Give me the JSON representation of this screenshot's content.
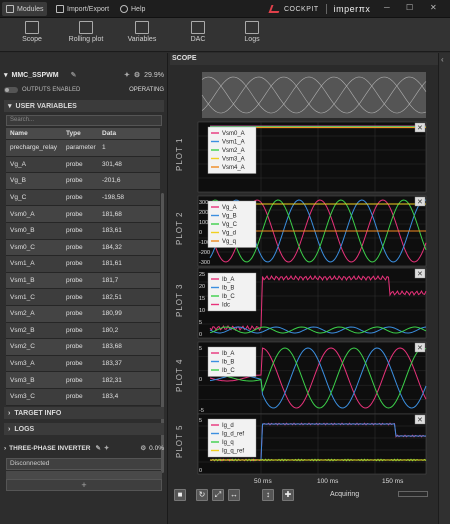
{
  "titlebar": {
    "tabs": [
      {
        "label": "Modules",
        "icon": "modules-icon"
      },
      {
        "label": "Import/Export",
        "icon": "folder-icon"
      },
      {
        "label": "Help",
        "icon": "help-icon"
      }
    ],
    "brand": "COCKPIT",
    "brand2": "imperπx",
    "controls": [
      "─",
      "☐",
      "✕"
    ]
  },
  "toolbar": {
    "items": [
      "Scope",
      "Rolling plot",
      "Variables",
      "DAC",
      "Logs"
    ]
  },
  "module": {
    "name": "MMC_SSPWM",
    "cpu": "29.9%",
    "outputs_label": "OUTPUTS ENABLED",
    "state": "OPERATING"
  },
  "user_variables": {
    "title": "USER VARIABLES",
    "search_placeholder": "Search...",
    "columns": [
      "Name",
      "Type",
      "Data"
    ],
    "rows": [
      [
        "precharge_relay",
        "parameter",
        "1"
      ],
      [
        "Vg_A",
        "probe",
        "301,48"
      ],
      [
        "Vg_B",
        "probe",
        "-201,6"
      ],
      [
        "Vg_C",
        "probe",
        "-198,58"
      ],
      [
        "Vsm0_A",
        "probe",
        "181,68"
      ],
      [
        "Vsm0_B",
        "probe",
        "183,61"
      ],
      [
        "Vsm0_C",
        "probe",
        "184,32"
      ],
      [
        "Vsm1_A",
        "probe",
        "181,61"
      ],
      [
        "Vsm1_B",
        "probe",
        "181,7"
      ],
      [
        "Vsm1_C",
        "probe",
        "182,51"
      ],
      [
        "Vsm2_A",
        "probe",
        "180,99"
      ],
      [
        "Vsm2_B",
        "probe",
        "180,2"
      ],
      [
        "Vsm2_C",
        "probe",
        "183,68"
      ],
      [
        "Vsm3_A",
        "probe",
        "183,37"
      ],
      [
        "Vsm3_B",
        "probe",
        "182,31"
      ],
      [
        "Vsm3_C",
        "probe",
        "183,4"
      ]
    ]
  },
  "sections": {
    "target_info": "TARGET INFO",
    "logs": "LOGS"
  },
  "inverter": {
    "name": "THREE-PHASE INVERTER",
    "cpu": "0.0%",
    "status": "Disconnected"
  },
  "scope": {
    "title": "SCOPE",
    "acquiring": "Acquiring",
    "time_ticks": [
      "50 ms",
      "100 ms",
      "150 ms"
    ],
    "plots": [
      {
        "label": "PLOT 1",
        "legend": [
          "Vsm0_A",
          "Vsm1_A",
          "Vsm2_A",
          "Vsm3_A",
          "Vsm4_A"
        ],
        "colors": [
          "#e8327a",
          "#3b8fe0",
          "#3cd04a",
          "#f0d020",
          "#f08a20"
        ],
        "ticks": []
      },
      {
        "label": "PLOT 2",
        "legend": [
          "Vg_A",
          "Vg_B",
          "Vg_C",
          "Vg_d",
          "Vg_q"
        ],
        "colors": [
          "#e8327a",
          "#3b8fe0",
          "#3cd04a",
          "#f0d020",
          "#f08a20"
        ],
        "ticks": [
          "300",
          "200",
          "100",
          "0",
          "-100",
          "-200",
          "-300"
        ]
      },
      {
        "label": "PLOT 3",
        "legend": [
          "Ib_A",
          "Ib_B",
          "Ib_C",
          "Idc"
        ],
        "colors": [
          "#e8327a",
          "#3b8fe0",
          "#3cd04a",
          "#e8327a"
        ],
        "ticks": [
          "25",
          "20",
          "15",
          "10",
          "5",
          "0"
        ]
      },
      {
        "label": "PLOT 4",
        "legend": [
          "Ib_A",
          "Ib_B",
          "Ib_C"
        ],
        "colors": [
          "#e8327a",
          "#3b8fe0",
          "#3cd04a"
        ],
        "ticks": [
          "5",
          "0",
          "-5"
        ]
      },
      {
        "label": "PLOT 5",
        "legend": [
          "Ig_d",
          "Ig_d_ref",
          "Ig_q",
          "Ig_q_ref"
        ],
        "colors": [
          "#e8327a",
          "#3b8fe0",
          "#3cd04a",
          "#f0d020"
        ],
        "ticks": [
          "5",
          "0"
        ]
      }
    ]
  },
  "bottom_buttons": [
    "■",
    "↻",
    "⤢",
    "↔",
    "↕",
    "✚"
  ]
}
